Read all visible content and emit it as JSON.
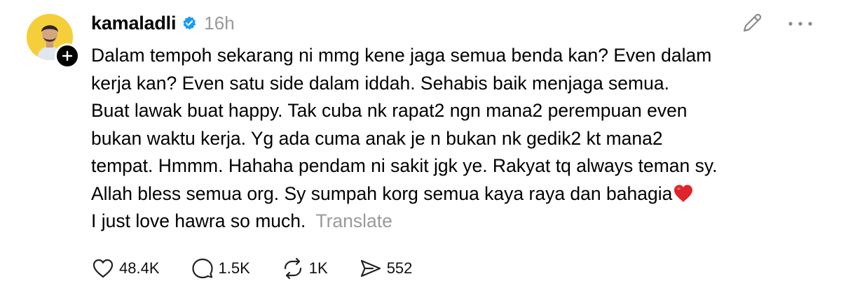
{
  "post": {
    "username": "kamaladli",
    "timestamp": "16h",
    "lines": [
      "Dalam tempoh sekarang ni mmg kene jaga semua benda kan? Even dalam",
      "kerja kan? Even satu side dalam iddah. Sehabis baik menjaga semua.",
      "Buat lawak buat happy. Tak cuba nk rapat2 ngn mana2 perempuan even",
      "bukan waktu kerja. Yg ada cuma anak je n bukan nk gedik2 kt mana2",
      "tempat. Hmmm. Hahaha pendam ni sakit jgk ye. Rakyat tq always teman sy.",
      "Allah bless semua org. Sy sumpah korg semua kaya raya dan bahagia",
      "I just love hawra so much."
    ],
    "translate_label": "Translate"
  },
  "actions": {
    "likes": "48.4K",
    "replies": "1.5K",
    "reposts": "1K",
    "shares": "552"
  },
  "icons": {
    "avatar": "profile-photo",
    "follow": "plus-icon",
    "verified": "verified-badge-icon",
    "edit": "pencil-icon",
    "more": "more-dots-icon",
    "like": "heart-icon",
    "reply": "comment-icon",
    "repost": "repost-icon",
    "share": "send-icon",
    "emoji": "red-heart-emoji"
  },
  "colors": {
    "verified": "#1d9bf0",
    "muted": "#999999",
    "avatar_bg": "#f4cf3a",
    "heart_emoji": "#e0242b"
  }
}
